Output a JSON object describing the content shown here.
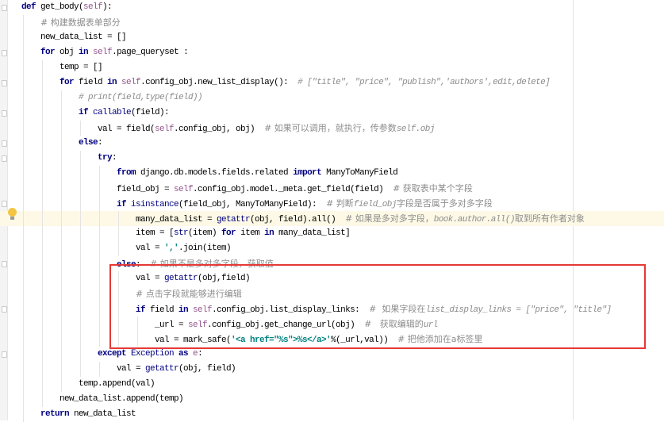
{
  "editor": {
    "highlighted_line": 14,
    "annotation_color": "#e53935",
    "lines": [
      {
        "indent": 0,
        "fold": true,
        "seg": [
          [
            "k",
            "def "
          ],
          [
            "n",
            "get_body("
          ],
          [
            "s",
            "self"
          ],
          [
            "n",
            "):"
          ]
        ]
      },
      {
        "indent": 1,
        "seg": [
          [
            "c",
            "# 构建数据表单部分"
          ]
        ]
      },
      {
        "indent": 1,
        "seg": [
          [
            "n",
            "new_data_list = []"
          ]
        ]
      },
      {
        "indent": 1,
        "fold": true,
        "seg": [
          [
            "k",
            "for "
          ],
          [
            "n",
            "obj "
          ],
          [
            "k",
            "in "
          ],
          [
            "s",
            "self"
          ],
          [
            "n",
            ".page_queryset :"
          ]
        ]
      },
      {
        "indent": 2,
        "seg": [
          [
            "n",
            "temp = []"
          ]
        ]
      },
      {
        "indent": 2,
        "fold": true,
        "seg": [
          [
            "k",
            "for "
          ],
          [
            "n",
            "field "
          ],
          [
            "k",
            "in "
          ],
          [
            "s",
            "self"
          ],
          [
            "n",
            ".config_obj.new_list_display():  "
          ],
          [
            "ci",
            "# [\"title\", \"price\", \"publish\",'authors',edit,delete]"
          ]
        ]
      },
      {
        "indent": 3,
        "seg": [
          [
            "ci",
            "# print(field,type(field))"
          ]
        ]
      },
      {
        "indent": 3,
        "fold": true,
        "seg": [
          [
            "k",
            "if "
          ],
          [
            "b",
            "callable"
          ],
          [
            "n",
            "(field):"
          ]
        ]
      },
      {
        "indent": 4,
        "seg": [
          [
            "n",
            "val = field("
          ],
          [
            "s",
            "self"
          ],
          [
            "n",
            ".config_obj, obj)  "
          ],
          [
            "c",
            "# 如果可以调用，就执行，传参数"
          ],
          [
            "ci",
            "self.obj"
          ]
        ]
      },
      {
        "indent": 3,
        "fold": true,
        "seg": [
          [
            "k",
            "else"
          ],
          [
            "n",
            ":"
          ]
        ]
      },
      {
        "indent": 4,
        "fold": true,
        "seg": [
          [
            "k",
            "try"
          ],
          [
            "n",
            ":"
          ]
        ]
      },
      {
        "indent": 5,
        "seg": [
          [
            "k",
            "from "
          ],
          [
            "n",
            "django.db.models.fields.related "
          ],
          [
            "k",
            "import "
          ],
          [
            "n",
            "ManyToManyField"
          ]
        ]
      },
      {
        "indent": 5,
        "seg": [
          [
            "n",
            "field_obj = "
          ],
          [
            "s",
            "self"
          ],
          [
            "n",
            ".config_obj.model._meta.get_field(field)  "
          ],
          [
            "c",
            "# 获取表中某个字段"
          ]
        ]
      },
      {
        "indent": 5,
        "fold": true,
        "seg": [
          [
            "k",
            "if "
          ],
          [
            "b",
            "isinstance"
          ],
          [
            "n",
            "(field_obj, ManyToManyField):  "
          ],
          [
            "c",
            "# 判断"
          ],
          [
            "ci",
            "field_obj"
          ],
          [
            "c",
            "字段是否属于多对多字段"
          ]
        ]
      },
      {
        "indent": 6,
        "seg": [
          [
            "n",
            "many_data_list = "
          ],
          [
            "b",
            "getattr"
          ],
          [
            "n",
            "(obj, field).all()  "
          ],
          [
            "c",
            "# 如果是多对多字段，"
          ],
          [
            "ci",
            "book.author.all()"
          ],
          [
            "c",
            "取到所有作者对象"
          ]
        ]
      },
      {
        "indent": 6,
        "seg": [
          [
            "n",
            "item = ["
          ],
          [
            "b",
            "str"
          ],
          [
            "n",
            "(item) "
          ],
          [
            "k",
            "for "
          ],
          [
            "n",
            "item "
          ],
          [
            "k",
            "in "
          ],
          [
            "n",
            "many_data_list]"
          ]
        ]
      },
      {
        "indent": 6,
        "seg": [
          [
            "n",
            "val = "
          ],
          [
            "st",
            "','"
          ],
          [
            "n",
            ".join(item)"
          ]
        ]
      },
      {
        "indent": 5,
        "fold": true,
        "seg": [
          [
            "k",
            "else"
          ],
          [
            "n",
            ":  "
          ],
          [
            "c",
            "# 如果不是多对多字段，获取值"
          ]
        ]
      },
      {
        "indent": 6,
        "seg": [
          [
            "n",
            "val = "
          ],
          [
            "b",
            "getattr"
          ],
          [
            "n",
            "(obj,field)"
          ]
        ]
      },
      {
        "indent": 6,
        "seg": [
          [
            "c",
            "# 点击字段就能够进行编辑"
          ]
        ]
      },
      {
        "indent": 6,
        "fold": true,
        "seg": [
          [
            "k",
            "if "
          ],
          [
            "n",
            "field "
          ],
          [
            "k",
            "in "
          ],
          [
            "s",
            "self"
          ],
          [
            "n",
            ".config_obj.list_display_links:  "
          ],
          [
            "c",
            "#  如果字段在"
          ],
          [
            "ci",
            "list_display_links = [\"price\", \"title\"]"
          ]
        ]
      },
      {
        "indent": 7,
        "seg": [
          [
            "n",
            "_url = "
          ],
          [
            "s",
            "self"
          ],
          [
            "n",
            ".config_obj.get_change_url(obj)  "
          ],
          [
            "c",
            "#   获取编辑的"
          ],
          [
            "ci",
            "url"
          ]
        ]
      },
      {
        "indent": 7,
        "seg": [
          [
            "n",
            "val = mark_safe("
          ],
          [
            "st",
            "'<a href=\"%s\">%s</a>'"
          ],
          [
            "n",
            "%(_url,val))  "
          ],
          [
            "c",
            "# 把他添加在a标签里"
          ]
        ]
      },
      {
        "indent": 4,
        "fold": true,
        "seg": [
          [
            "k",
            "except "
          ],
          [
            "b",
            "Exception "
          ],
          [
            "k",
            "as "
          ],
          [
            "s",
            "e"
          ],
          [
            "n",
            ":"
          ]
        ]
      },
      {
        "indent": 5,
        "seg": [
          [
            "n",
            "val = "
          ],
          [
            "b",
            "getattr"
          ],
          [
            "n",
            "(obj, field)"
          ]
        ]
      },
      {
        "indent": 3,
        "seg": [
          [
            "n",
            "temp.append(val)"
          ]
        ]
      },
      {
        "indent": 2,
        "seg": [
          [
            "n",
            "new_data_list.append(temp)"
          ]
        ]
      },
      {
        "indent": 1,
        "seg": [
          [
            "k",
            "return "
          ],
          [
            "n",
            "new_data_list"
          ]
        ]
      }
    ]
  }
}
